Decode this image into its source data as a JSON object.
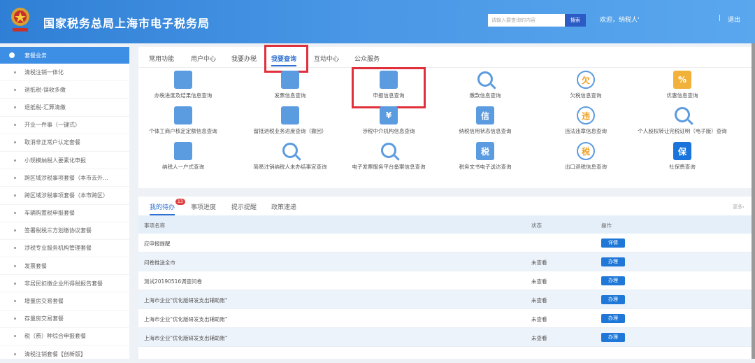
{
  "header": {
    "title": "国家税务总局上海市电子税务局",
    "search_placeholder": "请输入要查询的内容",
    "search_button": "搜索",
    "welcome": "欢迎，纳税人'",
    "separator": "|",
    "logout": "退出"
  },
  "sidebar": {
    "active": "套餐业务",
    "items": [
      "清税注销一体化",
      "退抵税-误收多缴",
      "退抵税-汇算清缴",
      "开业一件事（一键式）",
      "取消非正常户认定套餐",
      "小规模纳税人要素化申报",
      "跨区域涉税事项套餐（本市去外…",
      "跨区域涉税事项套餐（本市跨区）",
      "车辆购置税申报套餐",
      "签署税税三方划缴协议套餐",
      "涉税专业服务机构管理套餐",
      "发票套餐",
      "非居民扣缴企业所得税报告套餐",
      "增量房交易套餐",
      "存量房交易套餐",
      "税（费）种综合申报套餐",
      "清税注销套餐【创新版】"
    ]
  },
  "main_tabs": [
    "常用功能",
    "用户中心",
    "我要办税",
    "我要查询",
    "互动中心",
    "公众服务"
  ],
  "active_tab": "我要查询",
  "query_items": [
    {
      "label": "办税进度及结果信息查询",
      "icon": "progress-search-icon"
    },
    {
      "label": "发票信息查询",
      "icon": "invoice-search-icon"
    },
    {
      "label": "申报信息查询",
      "icon": "declaration-info-icon"
    },
    {
      "label": "缴款信息查询",
      "icon": "search-icon"
    },
    {
      "label": "欠税信息查询",
      "icon": "owed-tax-icon"
    },
    {
      "label": "优惠信息查询",
      "icon": "discount-icon"
    },
    {
      "label": "个体工商户核定定额信息查询",
      "icon": "business-owner-icon"
    },
    {
      "label": "留抵退税业务进度查询（撤回）",
      "icon": "progress-search-icon"
    },
    {
      "label": "涉税中介机构信息查询",
      "icon": "yuan-doc-icon"
    },
    {
      "label": "纳税信用状态信息查询",
      "icon": "credit-icon"
    },
    {
      "label": "违法违章信息查询",
      "icon": "violation-icon"
    },
    {
      "label": "个人股权转让完税证明（电子版）查询",
      "icon": "search-icon"
    },
    {
      "label": "纳税人一户式查询",
      "icon": "taxpayer-card-icon"
    },
    {
      "label": "简易注销纳税人未办结事宜查询",
      "icon": "search-icon"
    },
    {
      "label": "电子发票服务平台备案信息查询",
      "icon": "search-icon"
    },
    {
      "label": "税务文书电子送达查询",
      "icon": "tax-document-icon"
    },
    {
      "label": "出口退税信息查询",
      "icon": "export-refund-icon"
    },
    {
      "label": "社保费查询",
      "icon": "social-insurance-icon"
    }
  ],
  "icon_text": {
    "owed": "欠",
    "credit": "信",
    "violation": "违",
    "yuan": "¥",
    "tax": "税",
    "bao": "保",
    "discount": "%"
  },
  "todo": {
    "tabs": [
      "我的待办",
      "事项进度",
      "提示提醒",
      "政策速递"
    ],
    "badge": "13",
    "more": "更多›",
    "columns": [
      "事项名称",
      "状态",
      "操作"
    ],
    "rows": [
      {
        "name": "应申报提醒",
        "status": "",
        "action": "详情"
      },
      {
        "name": "问卷推送全市",
        "status": "未查看",
        "action": "办理"
      },
      {
        "name": "测试20190516调查问卷",
        "status": "未查看",
        "action": "办理"
      },
      {
        "name": "上海市企业\"优化版研发支出辅助账\"",
        "status": "未查看",
        "action": "办理"
      },
      {
        "name": "上海市企业\"优化版研发支出辅助账\"",
        "status": "未查看",
        "action": "办理"
      },
      {
        "name": "上海市企业\"优化版研发支出辅助账\"",
        "status": "未查看",
        "action": "办理"
      }
    ]
  },
  "colors": {
    "header": "#3d8fe6",
    "accent": "#2f6fd0",
    "highlight": "#e0303c",
    "button": "#1f78d8"
  }
}
